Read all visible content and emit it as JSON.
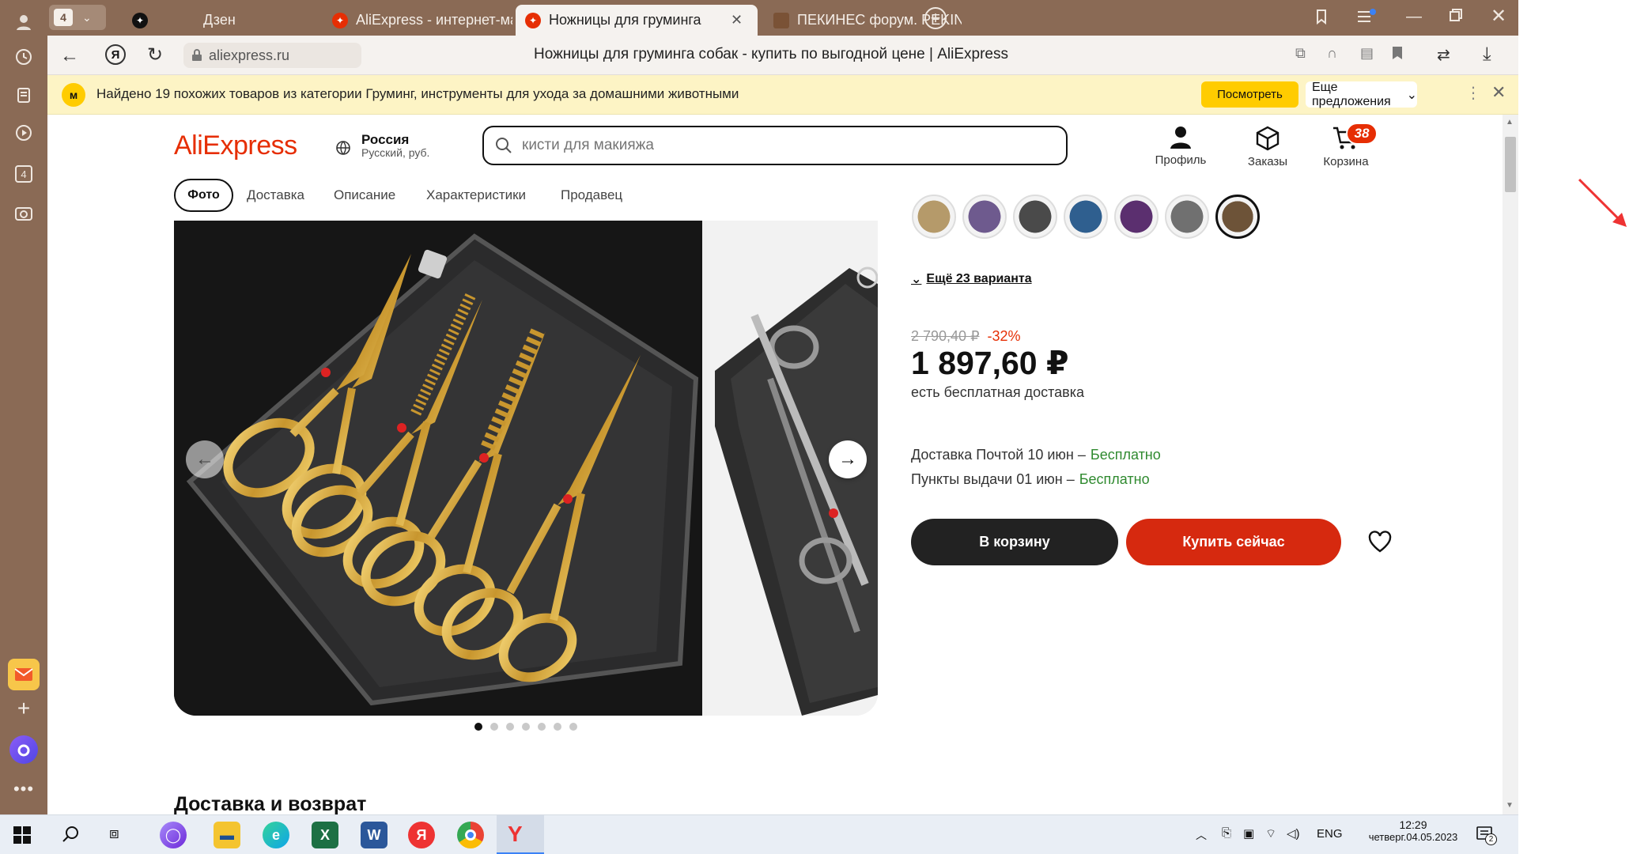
{
  "tabs": [
    {
      "label": "Дзен"
    },
    {
      "label": "AliExpress - интернет-мага"
    },
    {
      "label": "Ножницы для груминга"
    },
    {
      "label": "ПЕКИНЕС форум. PEKINGE"
    }
  ],
  "tab_group_count": "4",
  "address": {
    "url": "aliexpress.ru",
    "page_title": "Ножницы для груминга собак - купить по выгодной цене | AliExpress"
  },
  "infobar": {
    "text": "Найдено 19 похожих товаров из категории Груминг, инструменты для ухода за домашними животными",
    "view_button": "Посмотреть",
    "more_offers": "Еще предложения"
  },
  "site": {
    "logo": "AliExpress",
    "region": "Россия",
    "region_sub": "Русский, руб.",
    "search_placeholder": "кисти для макияжа",
    "profile": "Профиль",
    "orders": "Заказы",
    "cart": "Корзина",
    "cart_count": "38"
  },
  "nav_tabs": [
    {
      "label": "Фото"
    },
    {
      "label": "Доставка"
    },
    {
      "label": "Описание"
    },
    {
      "label": "Характеристики"
    },
    {
      "label": "Продавец"
    }
  ],
  "product": {
    "more_variants": "Ещё 23 варианта",
    "old_price": "2 790,40 ₽",
    "discount": "-32%",
    "price": "1 897,60 ₽",
    "free_shipping": "есть бесплатная доставка",
    "delivery_post": "Доставка Почтой 10 июн –",
    "delivery_post_price": "Бесплатно",
    "delivery_points": "Пункты выдачи 01 июн –",
    "delivery_points_price": "Бесплатно",
    "add_to_cart": "В корзину",
    "buy_now": "Купить сейчас",
    "gallery_current_slide": 1,
    "gallery_slide_count": 7
  },
  "section_heading": "Доставка и возврат",
  "swatch_colors": [
    "#b59a6a",
    "#6e5a8e",
    "#4a4a4a",
    "#2f5f8f",
    "#5b2f6f",
    "#707070",
    "#6d5338"
  ],
  "taskbar": {
    "lang": "ENG",
    "time": "12:29",
    "date": "четверг.04.05.2023",
    "notifications": "2"
  },
  "colors": {
    "accent_red": "#e62e04",
    "buy_red": "#d6290f",
    "cart_black": "#222",
    "free_green": "#2f8a2f",
    "infobar_bg": "#fdf4c5",
    "view_btn_yellow": "#ffcc00"
  }
}
